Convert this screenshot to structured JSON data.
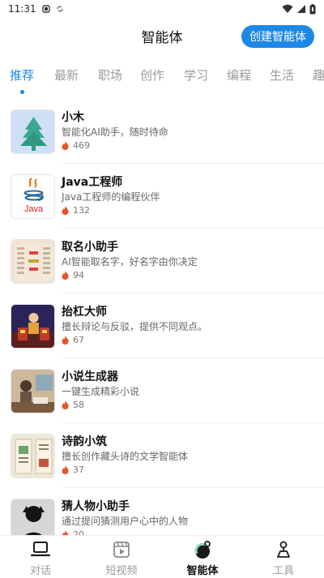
{
  "status_bar": {
    "time": "11:31"
  },
  "header": {
    "title": "智能体",
    "create_button": "创建智能体"
  },
  "tabs": [
    {
      "label": "推荐",
      "active": true
    },
    {
      "label": "最新"
    },
    {
      "label": "职场"
    },
    {
      "label": "创作"
    },
    {
      "label": "学习"
    },
    {
      "label": "编程"
    },
    {
      "label": "生活"
    },
    {
      "label": "趣"
    }
  ],
  "agents": [
    {
      "name": "小木",
      "description": "智能化AI助手，随时待命",
      "count": "469",
      "icon": "tree-avatar"
    },
    {
      "name": "Java工程师",
      "description": "Java工程师的编程伙伴",
      "count": "132",
      "icon": "java-logo"
    },
    {
      "name": "取名小助手",
      "description": "AI智能取名字，好名字由你决定",
      "count": "94",
      "icon": "naming-chart"
    },
    {
      "name": "抬杠大师",
      "description": "擅长辩论与反驳，提供不同观点。",
      "count": "67",
      "icon": "debate-stage"
    },
    {
      "name": "小说生成器",
      "description": "一键生成精彩小说",
      "count": "58",
      "icon": "writer-desk"
    },
    {
      "name": "诗韵小筑",
      "description": "擅长创作藏头诗的文学智能体",
      "count": "37",
      "icon": "poetry-scroll"
    },
    {
      "name": "猜人物小助手",
      "description": "通过提问猜测用户心中的人物",
      "count": "20",
      "icon": "silhouette"
    }
  ],
  "bottom_nav": [
    {
      "label": "对话",
      "icon": "laptop-icon"
    },
    {
      "label": "短视频",
      "icon": "video-icon"
    },
    {
      "label": "智能体",
      "icon": "agent-icon",
      "active": true
    },
    {
      "label": "工具",
      "icon": "tools-icon"
    }
  ],
  "colors": {
    "accent": "#1e88e5",
    "fire": "#e8542a"
  }
}
